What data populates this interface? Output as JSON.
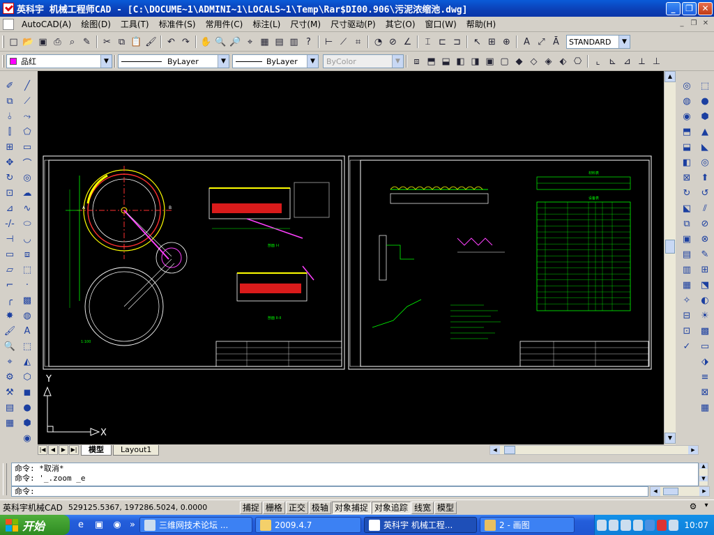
{
  "window": {
    "title": "英科宇 机械工程师CAD - [C:\\DOCUME~1\\ADMINI~1\\LOCALS~1\\Temp\\Rar$DI00.906\\污泥浓缩池.dwg]",
    "controls": [
      "minimize",
      "maximize",
      "close"
    ]
  },
  "menu": {
    "items": [
      "AutoCAD(A)",
      "绘图(D)",
      "工具(T)",
      "标准件(S)",
      "常用件(C)",
      "标注(L)",
      "尺寸(M)",
      "尺寸驱动(P)",
      "其它(O)",
      "窗口(W)",
      "帮助(H)"
    ]
  },
  "toolbar": {
    "text_style": "STANDARD",
    "layer": "品红",
    "linetype": "ByLayer",
    "lineweight": "ByLayer",
    "plotstyle": "ByColor"
  },
  "canvas": {
    "ucs_y": "Y",
    "ucs_x": "X"
  },
  "drawing": {
    "sheet1_labels": [
      "A",
      "B",
      "剖面 I-I",
      "剖面 II-II",
      "1:100"
    ],
    "sheet2_table_title": "材料表",
    "sheet2_table2_title": "设备表"
  },
  "tabs": {
    "items": [
      "模型",
      "Layout1"
    ],
    "active": "模型"
  },
  "command": {
    "history": [
      "命令: *取消*",
      "命令: '_.zoom _e"
    ],
    "prompt": "命令:"
  },
  "status": {
    "app_label": "英科宇机械CAD",
    "coords": "529125.5367, 197286.5024, 0.0000",
    "toggles": [
      {
        "label": "捕捉",
        "on": false
      },
      {
        "label": "栅格",
        "on": false
      },
      {
        "label": "正交",
        "on": false
      },
      {
        "label": "极轴",
        "on": false
      },
      {
        "label": "对象捕捉",
        "on": true
      },
      {
        "label": "对象追踪",
        "on": true
      },
      {
        "label": "线宽",
        "on": false
      },
      {
        "label": "模型",
        "on": false
      }
    ]
  },
  "taskbar": {
    "start_label": "开始",
    "tasks": [
      {
        "label": "三维网技术论坛 ...",
        "active": false
      },
      {
        "label": "2009.4.7",
        "active": false
      },
      {
        "label": "英科宇 机械工程...",
        "active": true
      },
      {
        "label": "2 - 画图",
        "active": false
      }
    ],
    "clock": "10:07"
  },
  "colors": {
    "titlebar": "#0b3fb5",
    "canvas_bg": "#000000",
    "taskbar": "#245edb",
    "start": "#2e8b22",
    "layer_swatch": "#ff00ff"
  }
}
